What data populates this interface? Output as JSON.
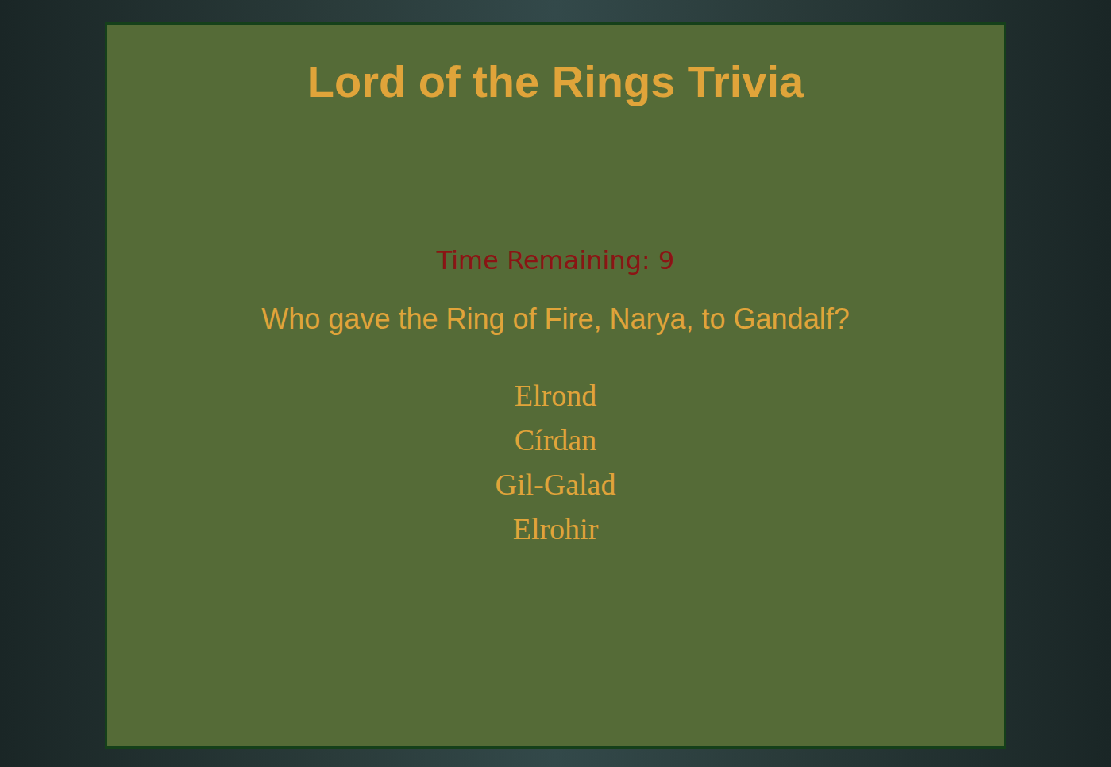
{
  "title": "Lord of the Rings Trivia",
  "timer": {
    "label": "Time Remaining:",
    "seconds": "9"
  },
  "question": "Who gave the Ring of Fire, Narya, to Gandalf?",
  "answers": [
    {
      "text": "Elrond"
    },
    {
      "text": "Círdan"
    },
    {
      "text": "Gil-Galad"
    },
    {
      "text": "Elrohir"
    }
  ]
}
